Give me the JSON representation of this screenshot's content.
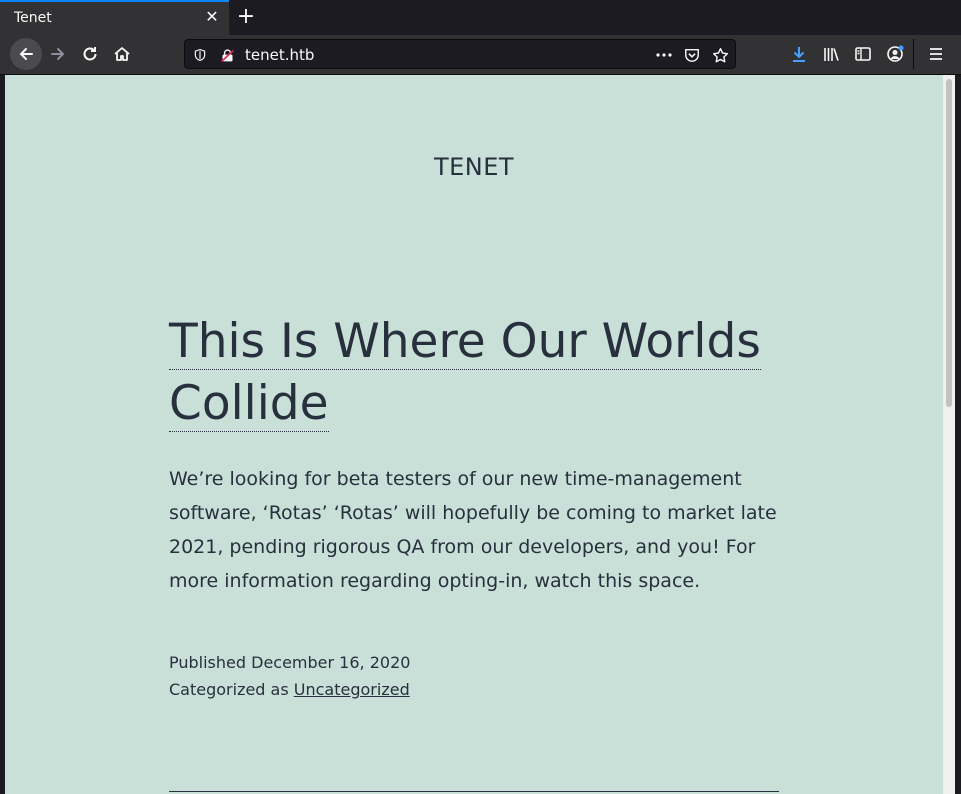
{
  "browser": {
    "tab_title": "Tenet",
    "url": "tenet.htb"
  },
  "page": {
    "site_title": "TENET",
    "post_title_line1": "This Is Where Our Worlds",
    "post_title_line2": "Collide",
    "post_body": "We’re looking for beta testers of our new time-management software, ‘Rotas’ ‘Rotas’ will hopefully be coming to market late 2021, pending rigorous QA from our developers, and you! For more information regarding opting-in, watch this space.",
    "published_label": "Published",
    "published_date": "December 16, 2020",
    "categorized_label": "Categorized as",
    "category": "Uncategorized"
  },
  "colors": {
    "page_background": "#c9e0d8",
    "text": "#28303d",
    "accent": "#0a84ff"
  }
}
